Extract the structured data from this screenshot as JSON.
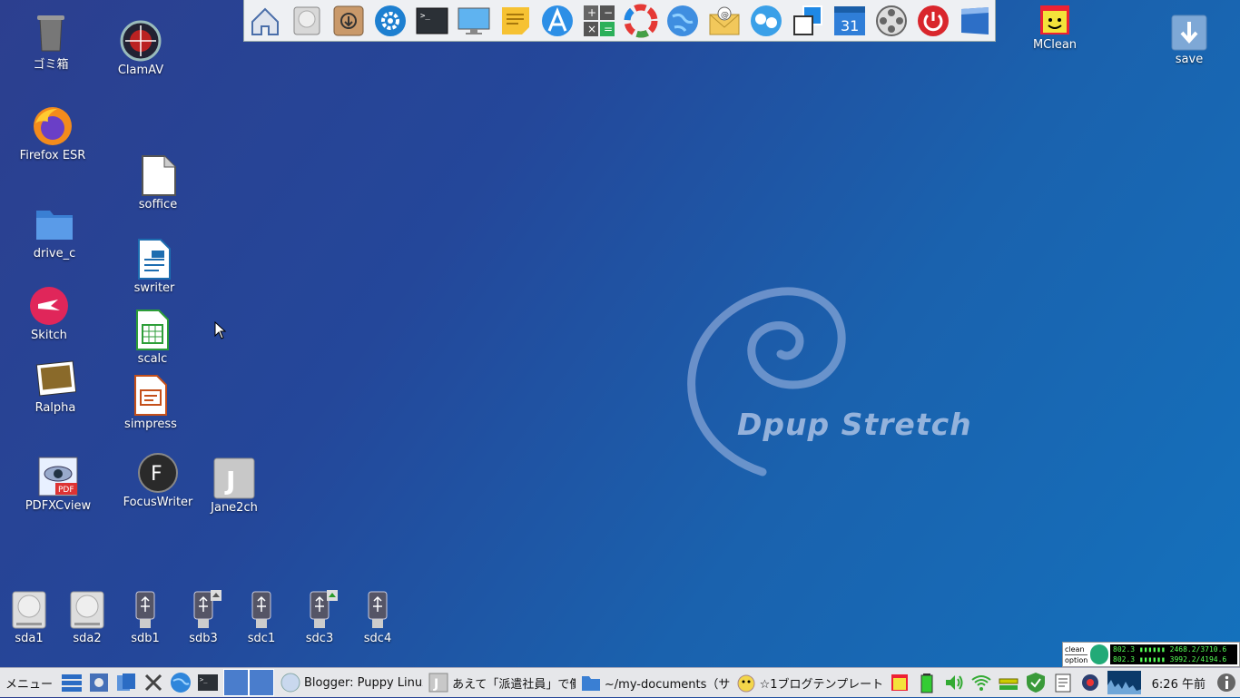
{
  "wallpaper": {
    "logo_text": "Dpup Stretch"
  },
  "desktop_icons": {
    "trash": "ゴミ箱",
    "clamav": "ClamAV",
    "firefox": "Firefox ESR",
    "drive_c": "drive_c",
    "soffice": "soffice",
    "swriter": "swriter",
    "skitch": "Skitch",
    "scalc": "scalc",
    "ralpha": "Ralpha",
    "simpress": "simpress",
    "pdfxcview": "PDFXCview",
    "focuswriter": "FocusWriter",
    "jane2ch": "Jane2ch",
    "mclean": "MClean",
    "save": "save"
  },
  "drives": [
    "sda1",
    "sda2",
    "sdb1",
    "sdb3",
    "sdc1",
    "sdc3",
    "sdc4"
  ],
  "launcher_icons": [
    "home-icon",
    "drive-icon",
    "install-icon",
    "settings-icon",
    "terminal-icon",
    "display-icon",
    "notes-icon",
    "browser-a-icon",
    "calculator-icon",
    "color-wheel-icon",
    "globe-icon",
    "mail-icon",
    "chat-icon",
    "windows-icon",
    "calendar-icon",
    "film-reel-icon",
    "power-icon",
    "window-icon"
  ],
  "launcher": {
    "calendar_day": "31"
  },
  "taskbar": {
    "menu_label": "メニュー",
    "tasks": [
      {
        "label": "Blogger: Puppy Linux"
      },
      {
        "label": "あえて「派遣社員」で働"
      },
      {
        "label": "~/my-documents（サム"
      },
      {
        "label": "☆1ブログテンプレート"
      }
    ],
    "clock": "6:26 午前"
  },
  "monitor": {
    "clean": "clean",
    "option": "option",
    "line1a": "802.3",
    "line1b": "2468.2/3710.6",
    "line2a": "802.3",
    "line2b": "3992.2/4194.6"
  },
  "colors": {
    "bg_top": "#2c3f8f",
    "bg_bottom": "#1472bd",
    "taskbar_bg": "#e6e7ea",
    "launcher_bg": "#eef0f3"
  }
}
